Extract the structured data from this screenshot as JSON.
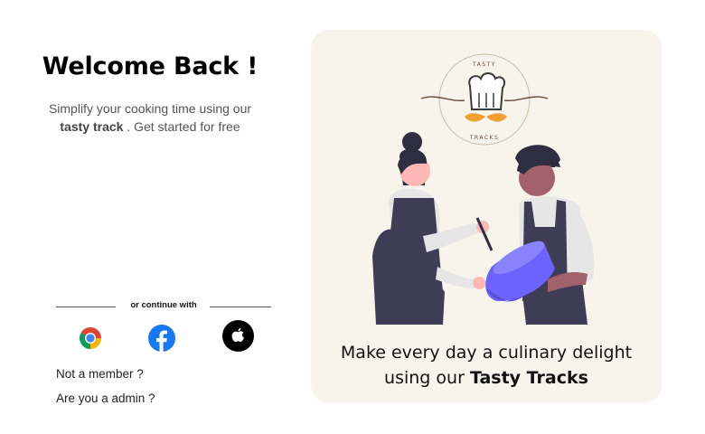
{
  "login": {
    "title": "Welcome Back !",
    "subtitle_line1": "Simplify your cooking time using our",
    "subtitle_bold": "tasty track",
    "subtitle_rest": " . Get started for free",
    "divider_text": "or continue with",
    "social": [
      {
        "name": "Chrome",
        "icon": "chrome-icon"
      },
      {
        "name": "Facebook",
        "icon": "facebook-icon",
        "color": "#1877f2"
      },
      {
        "name": "Apple",
        "icon": "apple-icon",
        "color": "#000000"
      }
    ],
    "not_member": "Not a member ?",
    "admin": "Are you a admin ?"
  },
  "hero": {
    "logo_top": "TASTY",
    "logo_bottom": "TRACKS",
    "tagline_line1": "Make every day a culinary delight",
    "tagline_prefix": "using our ",
    "tagline_brand": "Tasty Tracks",
    "background_color": "#f7f5eb",
    "accent_bowl_color": "#6c63ff"
  }
}
